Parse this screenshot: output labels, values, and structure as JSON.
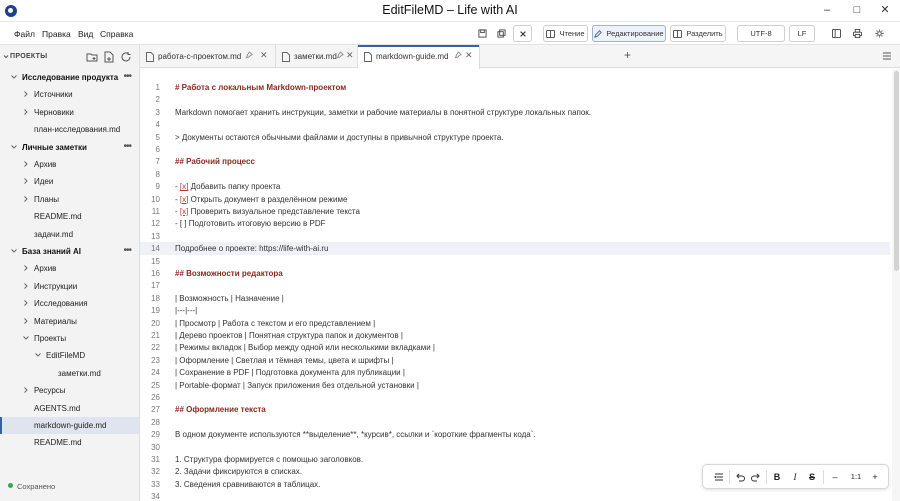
{
  "window": {
    "title": "EditFileMD – Life with AI"
  },
  "menu": [
    "Файл",
    "Правка",
    "Вид",
    "Справка"
  ],
  "toolbar": {
    "read_label": "Чтение",
    "edit_label": "Редактирование",
    "split_label": "Разделить",
    "encoding": "UTF-8",
    "line_ending": "LF"
  },
  "sidebar": {
    "title": "ПРОЕКТЫ",
    "status": "Сохранено",
    "tree": [
      {
        "label": "Исследование продукта",
        "kind": "section"
      },
      {
        "label": "Источники",
        "kind": "folder"
      },
      {
        "label": "Черновики",
        "kind": "folder"
      },
      {
        "label": "план-исследования.md",
        "kind": "file"
      },
      {
        "label": "Личные заметки",
        "kind": "section"
      },
      {
        "label": "Архив",
        "kind": "folder"
      },
      {
        "label": "Идеи",
        "kind": "folder"
      },
      {
        "label": "Планы",
        "kind": "folder"
      },
      {
        "label": "README.md",
        "kind": "file"
      },
      {
        "label": "задачи.md",
        "kind": "file"
      },
      {
        "label": "База знаний AI",
        "kind": "section"
      },
      {
        "label": "Архив",
        "kind": "folder"
      },
      {
        "label": "Инструкции",
        "kind": "folder"
      },
      {
        "label": "Исследования",
        "kind": "folder"
      },
      {
        "label": "Материалы",
        "kind": "folder"
      },
      {
        "label": "Проекты",
        "kind": "folder-open"
      },
      {
        "label": "EditFileMD",
        "kind": "folder-open"
      },
      {
        "label": "заметки.md",
        "kind": "file"
      },
      {
        "label": "Ресурсы",
        "kind": "folder"
      },
      {
        "label": "AGENTS.md",
        "kind": "file"
      },
      {
        "label": "markdown-guide.md",
        "kind": "file"
      },
      {
        "label": "README.md",
        "kind": "file"
      }
    ]
  },
  "tabs": [
    {
      "label": "работа-с-проектом.md"
    },
    {
      "label": "заметки.md"
    },
    {
      "label": "markdown-guide.md"
    }
  ],
  "editor": {
    "lines": [
      {
        "n": "1",
        "text": "# Работа с локальным Markdown-проектом"
      },
      {
        "n": "2",
        "text": ""
      },
      {
        "n": "3",
        "text": "Markdown помогает хранить инструкции, заметки и рабочие материалы в понятной структуре локальных папок."
      },
      {
        "n": "4",
        "text": ""
      },
      {
        "n": "5",
        "text": "> Документы остаются обычными файлами и доступны в привычной структуре проекта."
      },
      {
        "n": "6",
        "text": ""
      },
      {
        "n": "7",
        "text": "## Рабочий процесс"
      },
      {
        "n": "8",
        "text": ""
      },
      {
        "n": "9",
        "text": "- [x] Добавить папку проекта"
      },
      {
        "n": "10",
        "text": "- [x] Открыть документ в разделённом режиме"
      },
      {
        "n": "11",
        "text": "- [x] Проверить визуальное представление текста"
      },
      {
        "n": "12",
        "text": "- [ ] Подготовить итоговую версию в PDF"
      },
      {
        "n": "13",
        "text": ""
      },
      {
        "n": "14",
        "text": "Подробнее о проекте: https://life-with-ai.ru"
      },
      {
        "n": "15",
        "text": ""
      },
      {
        "n": "16",
        "text": "## Возможности редактора"
      },
      {
        "n": "17",
        "text": ""
      },
      {
        "n": "18",
        "text": "| Возможность | Назначение |"
      },
      {
        "n": "19",
        "text": "|---|---|"
      },
      {
        "n": "20",
        "text": "| Просмотр | Работа с текстом и его представлением |"
      },
      {
        "n": "21",
        "text": "| Дерево проектов | Понятная структура папок и документов |"
      },
      {
        "n": "22",
        "text": "| Режимы вкладок | Выбор между одной или несколькими вкладками |"
      },
      {
        "n": "23",
        "text": "| Оформление | Светлая и тёмная темы, цвета и шрифты |"
      },
      {
        "n": "24",
        "text": "| Сохранение в PDF | Подготовка документа для публикации |"
      },
      {
        "n": "25",
        "text": "| Portable-формат | Запуск приложения без отдельной установки |"
      },
      {
        "n": "26",
        "text": ""
      },
      {
        "n": "27",
        "text": "## Оформление текста"
      },
      {
        "n": "28",
        "text": ""
      },
      {
        "n": "29",
        "text": "В одном документе используются **выделение**, *курсив*, ссылки и `короткие фрагменты кода`."
      },
      {
        "n": "30",
        "text": ""
      },
      {
        "n": "31",
        "text": "1. Структура формируется с помощью заголовков."
      },
      {
        "n": "32",
        "text": "2. Задачи фиксируются в списках."
      },
      {
        "n": "33",
        "text": "3. Сведения сравниваются в таблицах."
      },
      {
        "n": "34",
        "text": ""
      }
    ]
  },
  "format_bar": {
    "bold": "B",
    "italic": "I",
    "strike": "S",
    "zoom_out": "–",
    "zoom": "1:1",
    "zoom_in": "+"
  },
  "colors": {
    "accent": "#3a5fa8",
    "heading": "#8a2a1f",
    "checkbox": "#b03b2a",
    "saved": "#3ca55c"
  }
}
